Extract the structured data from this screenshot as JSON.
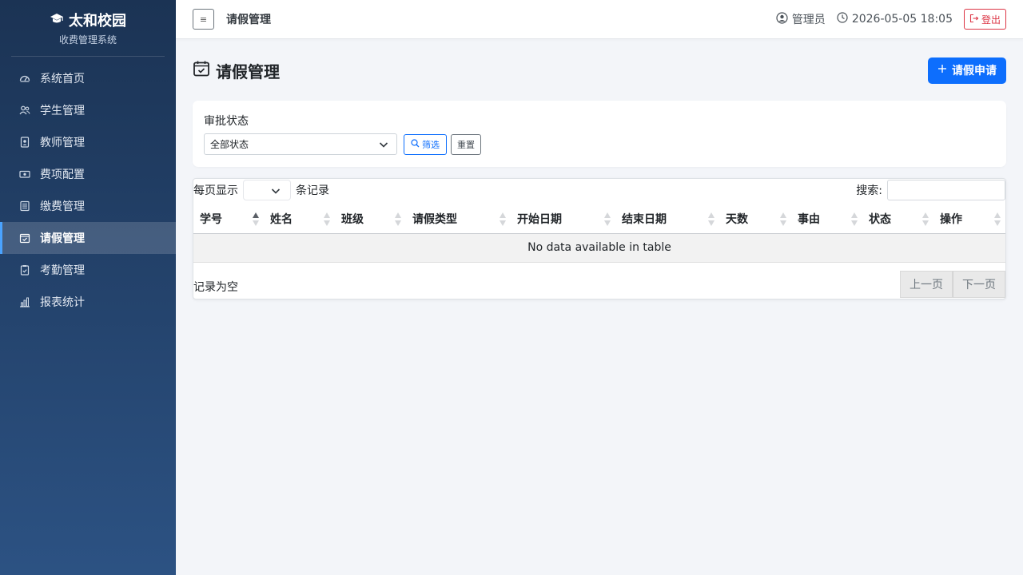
{
  "brand": {
    "title": "太和校园",
    "subtitle": "收费管理系统"
  },
  "sidebar": {
    "items": [
      {
        "label": "系统首页",
        "icon": "dashboard-icon"
      },
      {
        "label": "学生管理",
        "icon": "people-icon"
      },
      {
        "label": "教师管理",
        "icon": "badge-icon"
      },
      {
        "label": "费项配置",
        "icon": "cash-icon"
      },
      {
        "label": "缴费管理",
        "icon": "receipt-icon"
      },
      {
        "label": "请假管理",
        "icon": "calendar-check-icon",
        "active": true
      },
      {
        "label": "考勤管理",
        "icon": "clipboard-check-icon"
      },
      {
        "label": "报表统计",
        "icon": "bar-chart-icon"
      }
    ]
  },
  "header": {
    "toggle_label": "≡",
    "title": "请假管理",
    "user": "管理员",
    "datetime": "2026-05-05 18:05",
    "logout_label": "登出"
  },
  "page": {
    "title": "请假管理",
    "add_button": "请假申请"
  },
  "filter": {
    "label": "审批状态",
    "selected": "全部状态",
    "filter_button": "筛选",
    "reset_button": "重置"
  },
  "table": {
    "length_prefix": "每页显示",
    "length_suffix": "条记录",
    "search_label": "搜索:",
    "columns": [
      "学号",
      "姓名",
      "班级",
      "请假类型",
      "开始日期",
      "结束日期",
      "天数",
      "事由",
      "状态",
      "操作"
    ],
    "empty_text": "No data available in table",
    "info": "记录为空",
    "prev": "上一页",
    "next": "下一页"
  },
  "colors": {
    "primary": "#0d6efd",
    "danger": "#dc3545",
    "sidebar_top": "#1b3354",
    "sidebar_bottom": "#2c5283"
  }
}
